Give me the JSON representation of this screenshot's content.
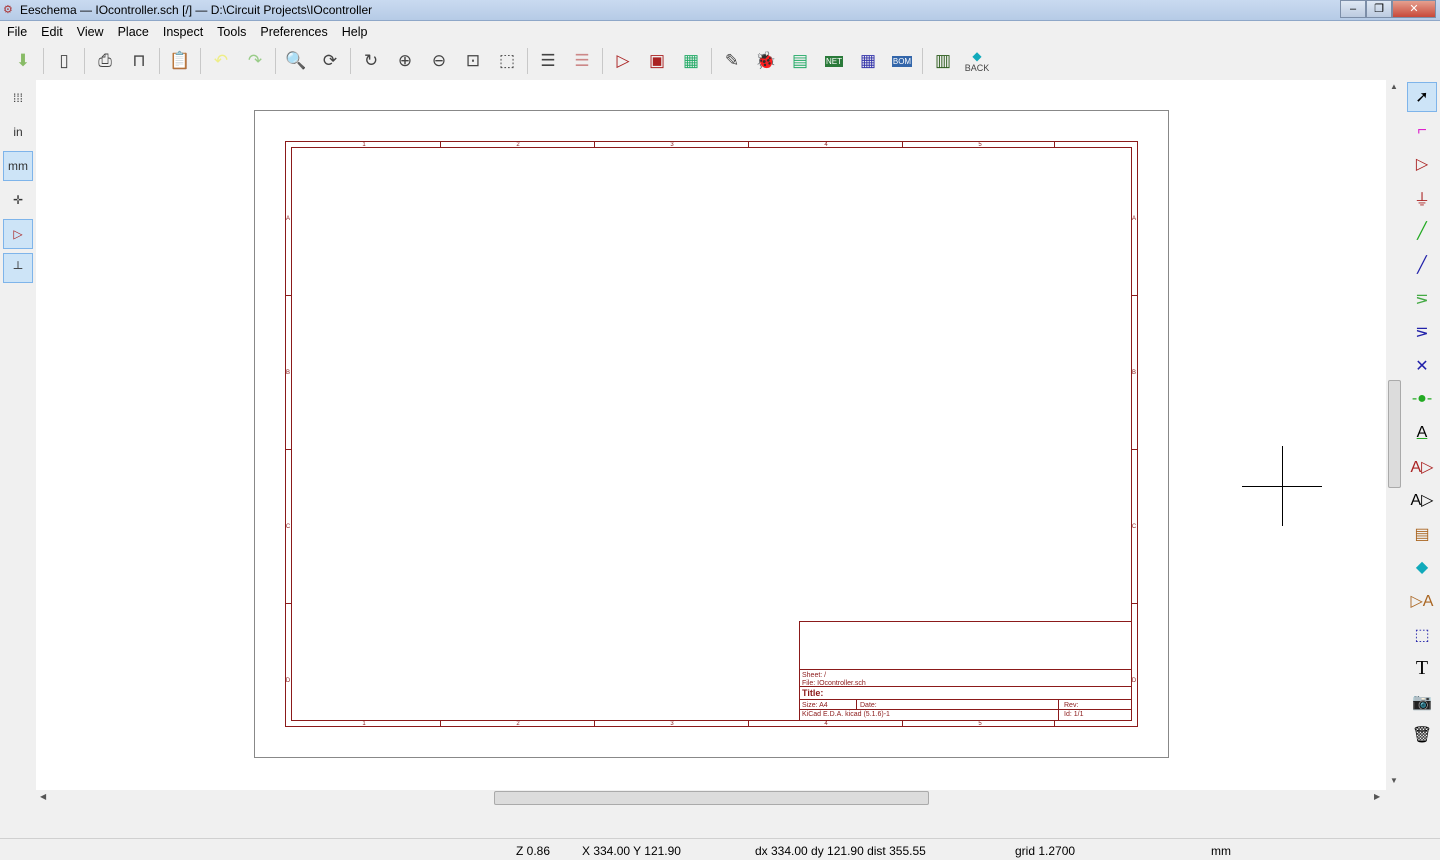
{
  "window": {
    "title": "Eeschema — IOcontroller.sch [/] — D:\\Circuit Projects\\IOcontroller"
  },
  "menu": [
    "File",
    "Edit",
    "View",
    "Place",
    "Inspect",
    "Tools",
    "Preferences",
    "Help"
  ],
  "toolbar": {
    "back_label": "BACK",
    "net_label": "NET",
    "bom_label": "BOM"
  },
  "left_toolbar": {
    "inch_label": "in",
    "mm_label": "mm"
  },
  "sheet": {
    "columns": [
      "1",
      "2",
      "3",
      "4",
      "5"
    ],
    "rows": [
      "A",
      "B",
      "C",
      "D"
    ],
    "title_block": {
      "sheet": "Sheet: /",
      "file": "File: IOcontroller.sch",
      "title": "Title:",
      "size": "Size: A4",
      "date": "Date:",
      "rev": "Rev:",
      "tool": "KiCad E.D.A.  kicad (5.1.6)-1",
      "id": "Id: 1/1"
    }
  },
  "status": {
    "zoom": "Z 0.86",
    "xy": "X 334.00  Y 121.90",
    "delta": "dx 334.00  dy 121.90  dist 355.55",
    "grid": "grid 1.2700",
    "units": "mm"
  }
}
